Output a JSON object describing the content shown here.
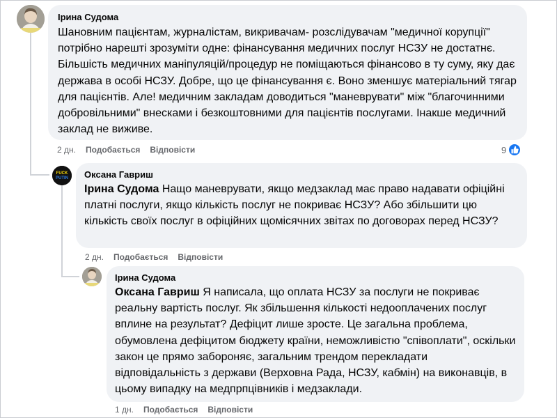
{
  "comments": [
    {
      "author": "Ірина Судома",
      "text": "Шановним пацієнтам, журналістам, викривачам- розслідувачам \"медичної корупції\" потрібно нарешті зрозуміти одне: фінансування медичних послуг НСЗУ не достатнє. Більшість медичних маніпуляцій/процедур не поміщаються фінансово в ту суму, яку дає держава в особі НСЗУ. Добре, що це фінансування є. Воно зменшує матеріальний тягар для пацієнтів. Але! медичним закладам доводиться \"маневрувати\" між \"благочинними добровільними\" внесками і безкоштовними для пацієнтів послугами. Інакше медичний заклад не виживе.",
      "time": "2 дн.",
      "like_label": "Подобається",
      "reply_label": "Відповісти",
      "reaction_count": "9"
    },
    {
      "author": "Оксана Гавриш",
      "mention": "Ірина Судома",
      "text": "Нащо маневрувати, якщо медзаклад має право надавати офіційні платні послуги, якщо кількість послуг не покриває НСЗУ? Або збільшити цю кількість своїх послуг в офіційних щомісячних звітах по договорах перед НСЗУ?",
      "time": "2 дн.",
      "like_label": "Подобається",
      "reply_label": "Відповісти",
      "avatar_text": "FUCK PUTIN"
    },
    {
      "author": "Ірина Судома",
      "mention": "Оксана Гавриш",
      "text": "Я написала, що оплата НСЗУ за послуги не покриває реальну вартість послуг. Як збільшення кількості недооплачених послуг вплине на результат? Дефіцит лише зросте. Це загальна проблема, обумовлена дефіцитом бюджету країни, неможливістю \"співоплати\", оскільки закон це прямо забороняє, загальним трендом перекладати відповідальність з держави (Верховна Рада, НСЗУ, кабмін) на виконавців, в цьому випадку на медпрпцівників і медзаклади.",
      "time": "1 дн.",
      "like_label": "Подобається",
      "reply_label": "Відповісти"
    }
  ],
  "colors": {
    "bubble": "#f0f2f5",
    "meta_text": "#65676b",
    "like_blue": "#1877f2",
    "thread_line": "#d0d3d8"
  },
  "icons": {
    "reaction": "thumbs-up-icon",
    "avatar": "avatar-photo"
  }
}
